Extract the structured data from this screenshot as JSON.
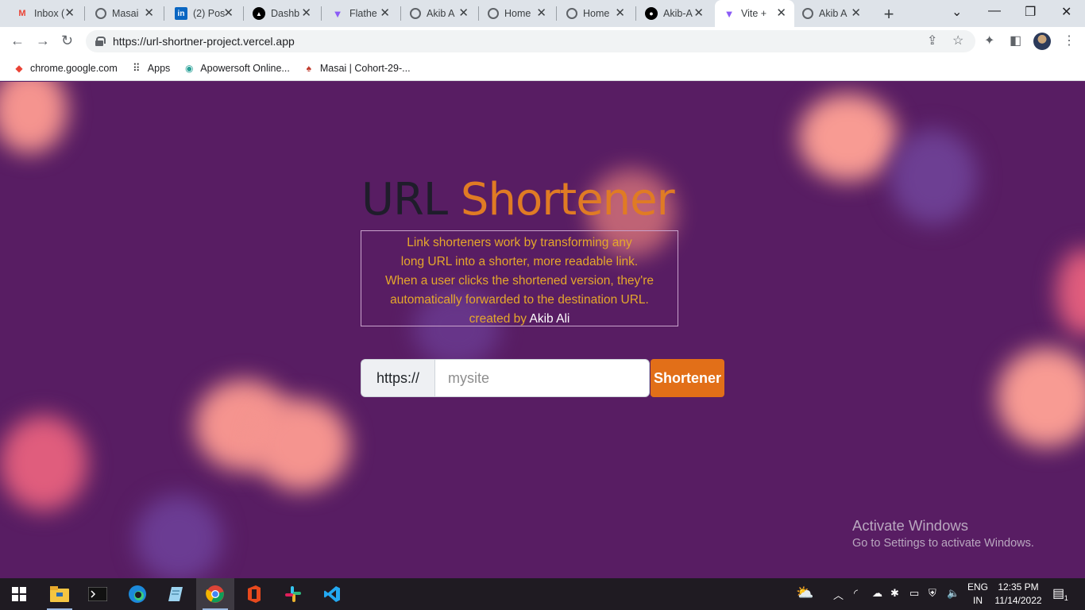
{
  "browser": {
    "tabs": [
      {
        "title": "Inbox (",
        "favicon": "gmail-icon",
        "color": "#ea4335"
      },
      {
        "title": "Masai",
        "favicon": "globe-icon",
        "color": "#5f6368"
      },
      {
        "title": "(2) Pos",
        "favicon": "linkedin-icon",
        "color": "#0a66c2"
      },
      {
        "title": "Dashb",
        "favicon": "vercel-icon",
        "color": "#000000"
      },
      {
        "title": "Flathe",
        "favicon": "vite-icon",
        "color": "#8b5cf6"
      },
      {
        "title": "Akib A",
        "favicon": "globe-icon",
        "color": "#5f6368"
      },
      {
        "title": "Home",
        "favicon": "globe-icon",
        "color": "#5f6368"
      },
      {
        "title": "Home",
        "favicon": "globe-icon",
        "color": "#5f6368"
      },
      {
        "title": "Akib-A",
        "favicon": "github-icon",
        "color": "#000000"
      },
      {
        "title": "Vite +",
        "favicon": "vite-icon",
        "color": "#8b5cf6",
        "active": true
      },
      {
        "title": "Akib A",
        "favicon": "globe-icon",
        "color": "#5f6368"
      }
    ],
    "url": "https://url-shortner-project.vercel.app",
    "bookmarks": [
      {
        "label": "chrome.google.com",
        "icon": "chrome-webstore-icon"
      },
      {
        "label": "Apps",
        "icon": "apps-grid-icon"
      },
      {
        "label": "Apowersoft Online...",
        "icon": "apowersoft-icon"
      },
      {
        "label": "Masai | Cohort-29-...",
        "icon": "masai-icon"
      }
    ]
  },
  "hero": {
    "title_part1": "URL",
    "title_part2": "Shortener",
    "description_lines": [
      "Link shorteners work by transforming any",
      "long URL into a shorter, more readable link.",
      "When a user clicks the shortened version, they're",
      "automatically forwarded to the destination URL."
    ],
    "credit_prefix": "created by",
    "credit_author": "Akib Ali"
  },
  "form": {
    "prefix": "https://",
    "placeholder": "mysite",
    "value": "",
    "button_label": "Shortener"
  },
  "watermark": {
    "line1": "Activate Windows",
    "line2": "Go to Settings to activate Windows."
  },
  "taskbar": {
    "language": "ENG",
    "region": "IN",
    "time": "12:35 PM",
    "date": "11/14/2022",
    "notification_count": "1"
  },
  "colors": {
    "page_background": "#581d63",
    "title_dark": "#1f1d2b",
    "title_accent": "#e07b24",
    "description_text": "#e5a72c",
    "button_background": "#e26f18"
  }
}
